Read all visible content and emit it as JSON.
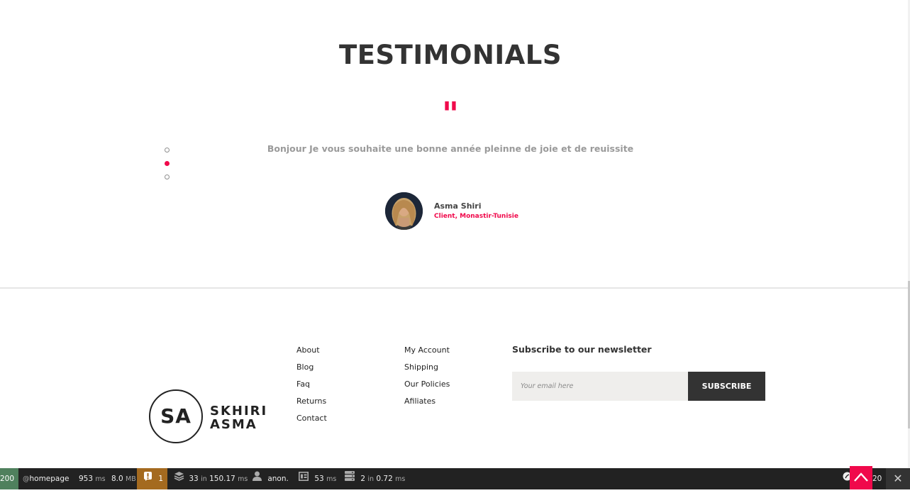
{
  "testimonials": {
    "title": "TESTIMONIALS",
    "quote_mark": "\"",
    "text": "Bonjour Je vous souhaite une bonne année pleinne de joie et de reuissite",
    "author_name": "Asma Shiri",
    "author_role": "Client, Monastir-Tunisie",
    "active_slide": 2,
    "slide_count": 3
  },
  "footer": {
    "logo": {
      "initials": "SA",
      "line1": "SKHIRI",
      "line2": "ASMA"
    },
    "links_col1": [
      "About",
      "Blog",
      "Faq",
      "Returns",
      "Contact"
    ],
    "links_col2": [
      "My Account",
      "Shipping",
      "Our Policies",
      "Afiliates"
    ],
    "newsletter": {
      "title": "Subscribe to our newsletter",
      "placeholder": "Your email here",
      "button_label": "SUBSCRIBE"
    }
  },
  "debug_toolbar": {
    "status_code": "200",
    "route_prefix": "@",
    "route": "homepage",
    "time_value": "953",
    "time_unit": "ms",
    "memory_value": "8.0",
    "memory_unit": "MB",
    "alert_count": "1",
    "db_queries": "33",
    "db_in": "in",
    "db_time": "150.17",
    "db_unit": "ms",
    "user": "anon.",
    "twig_time": "53",
    "twig_unit": "ms",
    "cache_calls": "2",
    "cache_in": "in",
    "cache_time": "0.72",
    "cache_unit": "ms",
    "version_fragment": "20",
    "close_glyph": "✕"
  },
  "colors": {
    "accent": "#f0094b",
    "dark": "#333333",
    "toolbar_bg": "#222222",
    "status_green": "#4f805d",
    "alert_amber": "#a46a1f"
  }
}
